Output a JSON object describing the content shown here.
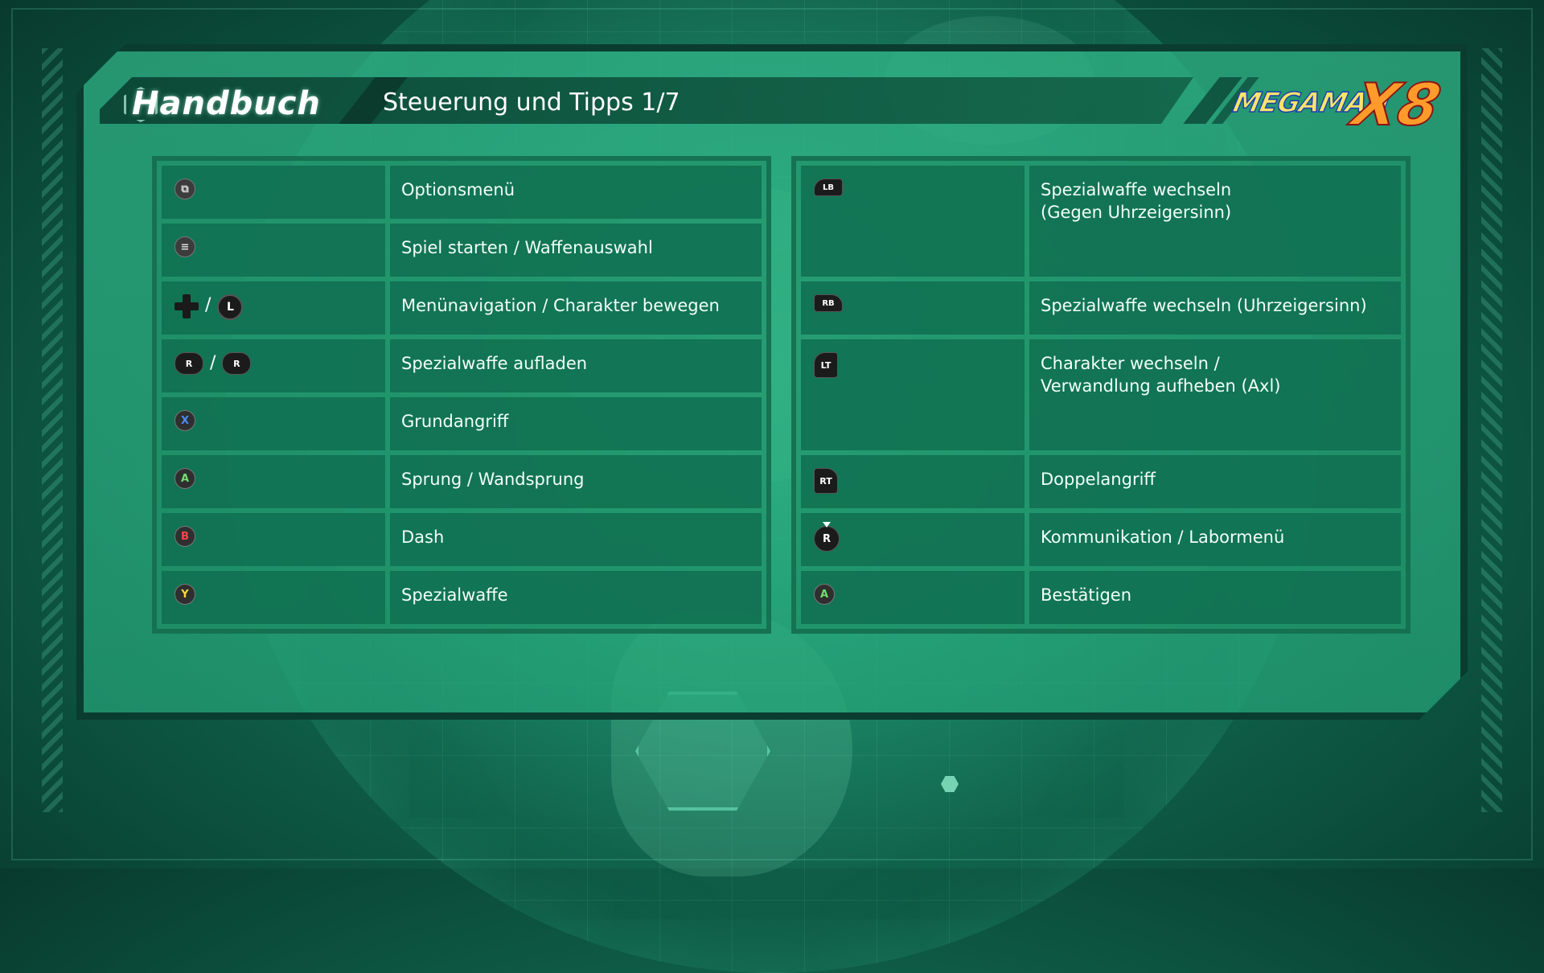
{
  "header": {
    "section_title": "Handbuch",
    "page_title": "Steuerung und Tipps 1/7",
    "logo_text": "MEGAMAN",
    "logo_number": "X8"
  },
  "icons": {
    "view": "⧉",
    "menu": "≡",
    "x": "X",
    "a": "A",
    "b": "B",
    "y": "Y",
    "l": "L",
    "r": "R",
    "lb": "LB",
    "rb": "RB",
    "lt": "LT",
    "rt": "RT",
    "slash": "/"
  },
  "left_controls": [
    {
      "desc": "Optionsmenü"
    },
    {
      "desc": "Spiel starten / Waffenauswahl"
    },
    {
      "desc": "Menünavigation / Charakter bewegen"
    },
    {
      "desc": "Spezialwaffe aufladen"
    },
    {
      "desc": "Grundangriff"
    },
    {
      "desc": "Sprung / Wandsprung"
    },
    {
      "desc": "Dash"
    },
    {
      "desc": "Spezialwaffe"
    }
  ],
  "right_controls": [
    {
      "desc_line1": "Spezialwaffe wechseln",
      "desc_line2": "(Gegen Uhrzeigersinn)"
    },
    {
      "desc": "Spezialwaffe wechseln (Uhrzeigersinn)"
    },
    {
      "desc_line1": "Charakter wechseln /",
      "desc_line2": "Verwandlung aufheben (Axl)"
    },
    {
      "desc": "Doppelangriff"
    },
    {
      "desc": "Kommunikation / Labormenü"
    },
    {
      "desc": "Bestätigen"
    }
  ]
}
